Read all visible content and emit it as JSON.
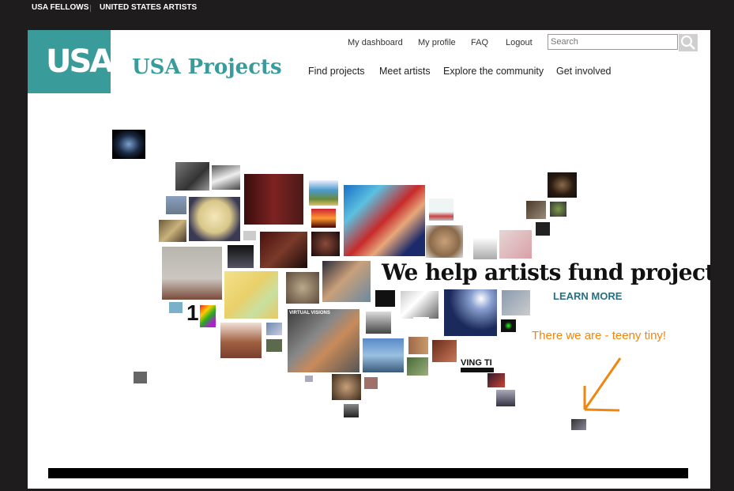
{
  "topbar": {
    "link1": "USA FELLOWS",
    "link2": "UNITED STATES ARTISTS"
  },
  "header": {
    "logo_text": "USA",
    "site_title": "USA Projects",
    "util_nav": {
      "dashboard": "My dashboard",
      "profile": "My profile",
      "faq": "FAQ",
      "logout": "Logout"
    },
    "search_placeholder": "Search",
    "main_nav": {
      "find": "Find projects",
      "meet": "Meet artists",
      "explore": "Explore the community",
      "involved": "Get involved"
    }
  },
  "hero": {
    "tagline": "We help artists fund projects.",
    "cta": "LEARN MORE",
    "annotation": "There we are - teeny tiny!",
    "inline_text_1": "VING TI",
    "inline_text_2": "VIRTUAL VISIONS",
    "inline_text_3": "1"
  },
  "colors": {
    "brand": "#3a9c9a",
    "annotation": "#f0860e",
    "cta": "#2a6e80",
    "frame": "#1e1c1d"
  },
  "icons": {
    "search": "magnifier-icon",
    "arrow": "arrow-down-left-icon"
  }
}
